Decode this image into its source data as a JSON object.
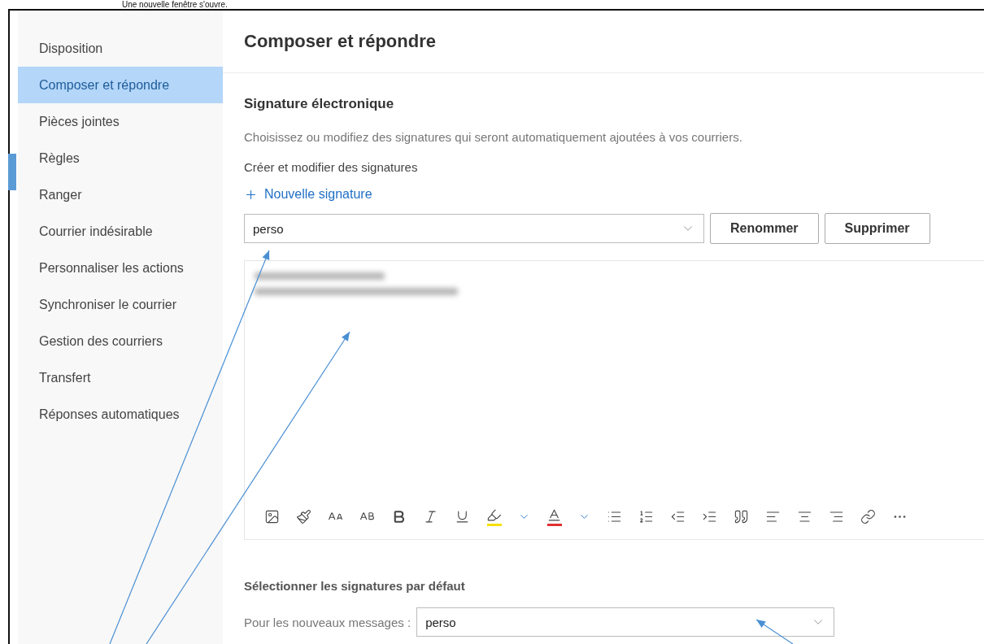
{
  "caption": "Une nouvelle fenêtre s'ouvre.",
  "sidebar": {
    "items": [
      {
        "label": "Disposition",
        "selected": false
      },
      {
        "label": "Composer et répondre",
        "selected": true
      },
      {
        "label": "Pièces jointes",
        "selected": false
      },
      {
        "label": "Règles",
        "selected": false
      },
      {
        "label": "Ranger",
        "selected": false
      },
      {
        "label": "Courrier indésirable",
        "selected": false
      },
      {
        "label": "Personnaliser les actions",
        "selected": false
      },
      {
        "label": "Synchroniser le courrier",
        "selected": false
      },
      {
        "label": "Gestion des courriers",
        "selected": false
      },
      {
        "label": "Transfert",
        "selected": false
      },
      {
        "label": "Réponses automatiques",
        "selected": false
      }
    ]
  },
  "page_title": "Composer et répondre",
  "section": {
    "title": "Signature électronique",
    "description": "Choisissez ou modifiez des signatures qui seront automatiquement ajoutées à vos courriers.",
    "subtitle": "Créer et modifier des signatures",
    "new_button": "Nouvelle signature",
    "signature_select": {
      "value": "perso"
    },
    "buttons": [
      "Renommer",
      "Supprimer"
    ]
  },
  "defaults": {
    "title": "Sélectionner les signatures par défaut",
    "new_messages": {
      "label": "Pour les nouveaux messages :",
      "value": "perso"
    }
  }
}
